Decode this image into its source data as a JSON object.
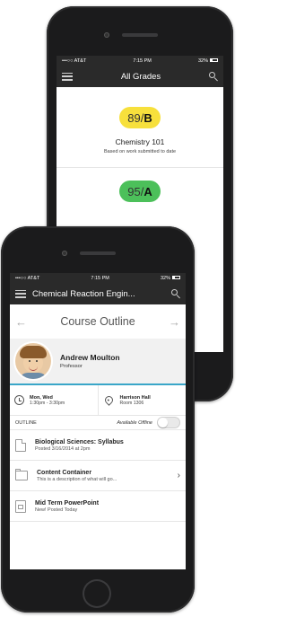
{
  "back_phone": {
    "status": {
      "carrier": "•••○○ AT&T",
      "time": "7:15 PM",
      "battery": "32%"
    },
    "title": "All Grades",
    "grades": [
      {
        "score": "89",
        "letter": "B",
        "color": "#f7e03c"
      },
      {
        "score": "95",
        "letter": "A",
        "color": "#4cc05a"
      }
    ],
    "course_name": "Chemistry 101",
    "course_sub": "Based on work submitted to date"
  },
  "front_phone": {
    "status": {
      "carrier": "•••○○ AT&T",
      "time": "7:15 PM",
      "battery": "32%"
    },
    "title": "Chemical Reaction Engin...",
    "course_header": "Course Outline",
    "professor": {
      "name": "Andrew Moulton",
      "role": "Professor"
    },
    "schedule": {
      "days": "Mon, Wed",
      "time": "1:30pm - 3:30pm"
    },
    "location": {
      "building": "Harrison Hall",
      "room": "Room 1306"
    },
    "outline_label": "OUTLINE",
    "offline_label": "Available Offline",
    "items": [
      {
        "title": "Biological Sciences: Syllabus",
        "sub": "Posted 3/16/2014 at 2pm",
        "icon": "pdf-icon"
      },
      {
        "title": "Content Container",
        "sub": "This is a description of what will go...",
        "icon": "folder-icon"
      },
      {
        "title": "Mid Term PowerPoint",
        "sub": "New! Posted Today",
        "icon": "ppt-icon"
      }
    ],
    "accent_color": "#3aa6c8"
  }
}
